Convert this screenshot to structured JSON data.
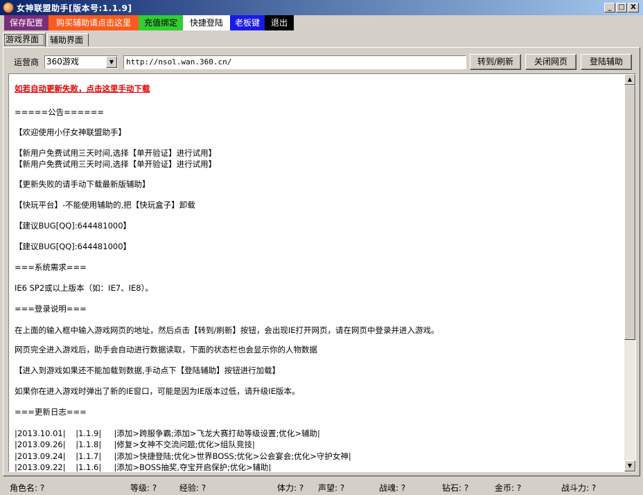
{
  "window": {
    "title": "女神联盟助手[版本号:1.1.9]",
    "controls": [
      "_",
      "□",
      "X"
    ]
  },
  "menubar": [
    {
      "label": "保存配置",
      "bg": "#7b2d7b",
      "fg": "#ffffff"
    },
    {
      "label": "购买辅助请点击这里",
      "bg": "#ff5a1e",
      "fg": "#ffffff"
    },
    {
      "label": "充值绑定",
      "bg": "#33cc33",
      "fg": "#000000"
    },
    {
      "label": "快捷登陆",
      "bg": "#ffffff",
      "fg": "#000000"
    },
    {
      "label": "老板键",
      "bg": "#1a1ae6",
      "fg": "#ffffff"
    },
    {
      "label": "退出",
      "bg": "#000000",
      "fg": "#ffffff"
    }
  ],
  "tabs": [
    {
      "label": "游戏界面",
      "active": true
    },
    {
      "label": "辅助界面",
      "active": false
    }
  ],
  "toolbar": {
    "isp_label": "运营商",
    "isp_value": "360游戏",
    "url": "http://nsol.wan.360.cn/",
    "goto_button": "转到/刷新",
    "close_button": "关闭网页",
    "login_button": "登陆辅助"
  },
  "content_lines": [
    {
      "text": "如若自动更新失败，点击这里手动下载",
      "style": "red"
    },
    {
      "text": "=====公告======"
    },
    {
      "text": "【欢迎使用小仔女神联盟助手】"
    },
    {
      "text": "【新用户免费试用三天时间,选择【单开验证】进行试用】"
    },
    {
      "text": "【新用户免费试用三天时间,选择【单开验证】进行试用】"
    },
    {
      "text": "【更新失败的请手动下载最新版辅助】"
    },
    {
      "text": "【快玩平台】-不能使用辅助的,把【快玩盒子】卸载"
    },
    {
      "text": "【建议BUG[QQ]:644481000】"
    },
    {
      "text": "【建议BUG[QQ]:644481000】"
    },
    {
      "text": "===系统需求==="
    },
    {
      "text": "IE6 SP2或以上版本（如：IE7、IE8）。"
    },
    {
      "text": "===登录说明==="
    },
    {
      "text": "在上面的输入框中输入游戏网页的地址，然后点击【转到/刷新】按钮，会出现IE打开网页，请在网页中登录并进入游戏。"
    },
    {
      "text": "网页完全进入游戏后，助手会自动进行数据读取，下面的状态栏也会显示你的人物数据"
    },
    {
      "text": "【进入到游戏如果还不能加载到数据,手动点下【登陆辅助】按钮进行加载】"
    },
    {
      "text": "如果你在进入游戏时弹出了新的IE窗口，可能是因为IE版本过低，请升级IE版本。"
    },
    {
      "text": "===更新日志==="
    },
    {
      "text": "|2013.10.01|    |1.1.9|     |添加>跨服争霸;添加>飞龙大赛打劫等级设置;优化>辅助|"
    },
    {
      "text": "|2013.09.26|    |1.1.8|     |修复>女神不交流问题;优化>组队竞技|"
    },
    {
      "text": "|2013.09.24|    |1.1.7|     |添加>快捷登陆;优化>世界BOSS;优化>公会宴会;优化>守护女神|"
    },
    {
      "text": "|2013.09.22|    |1.1.6|     |添加>BOSS抽奖,夺宝开启保护;优化>辅助|"
    }
  ],
  "status": [
    {
      "label": "角色名: ?"
    },
    {
      "label": "等级: ?"
    },
    {
      "label": "经验: ?"
    },
    {
      "label": "体力: ?"
    },
    {
      "label": "声望: ?"
    },
    {
      "label": "战魂: ?"
    },
    {
      "label": "钻石: ?"
    },
    {
      "label": "金币: ?"
    },
    {
      "label": "战斗力: ?"
    }
  ]
}
